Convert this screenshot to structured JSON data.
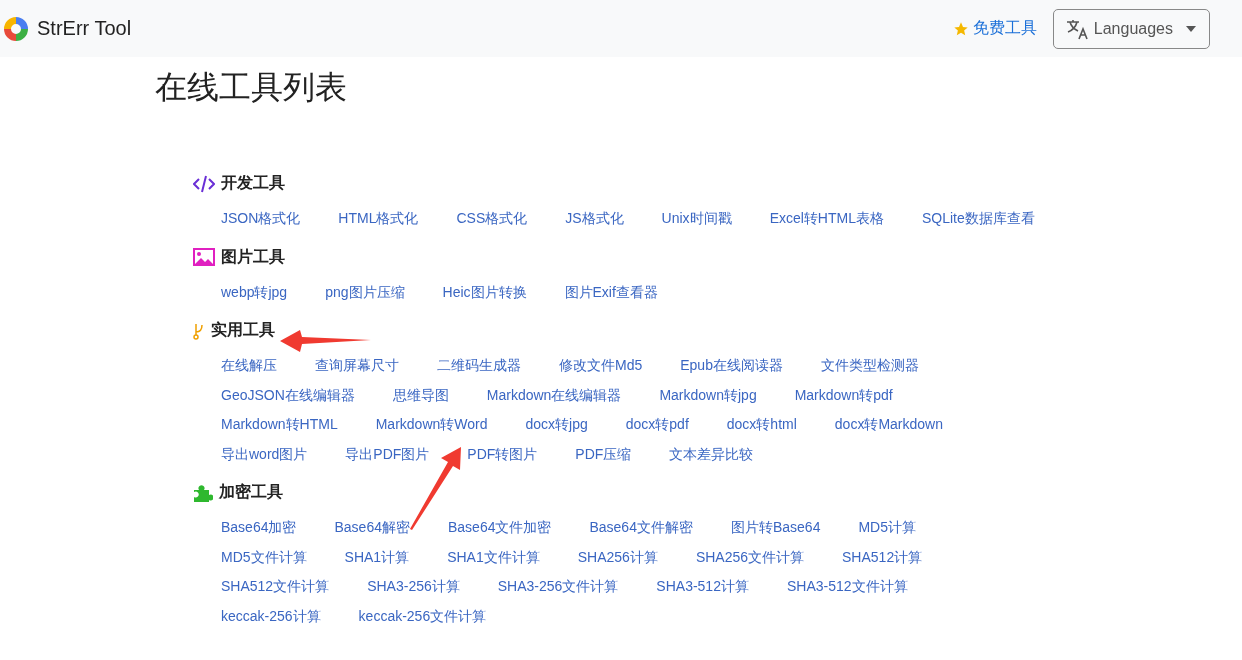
{
  "header": {
    "brand": "StrErr Tool",
    "free_tools": "免费工具",
    "languages": "Languages"
  },
  "title": "在线工具列表",
  "sections": [
    {
      "kind": "code",
      "heading": "开发工具",
      "rows": [
        [
          "JSON格式化",
          "HTML格式化",
          "CSS格式化",
          "JS格式化",
          "Unix时间戳",
          "Excel转HTML表格",
          "SQLite数据库查看"
        ]
      ]
    },
    {
      "kind": "image",
      "heading": "图片工具",
      "rows": [
        [
          "webp转jpg",
          "png图片压缩",
          "Heic图片转换",
          "图片Exif查看器"
        ]
      ]
    },
    {
      "kind": "utility",
      "heading": "实用工具",
      "rows": [
        [
          "在线解压",
          "查询屏幕尺寸",
          "二维码生成器",
          "修改文件Md5",
          "Epub在线阅读器",
          "文件类型检测器"
        ],
        [
          "GeoJSON在线编辑器",
          "思维导图",
          "Markdown在线编辑器",
          "Markdown转jpg",
          "Markdown转pdf"
        ],
        [
          "Markdown转HTML",
          "Markdown转Word",
          "docx转jpg",
          "docx转pdf",
          "docx转html",
          "docx转Markdown"
        ],
        [
          "导出word图片",
          "导出PDF图片",
          "PDF转图片",
          "PDF压缩",
          "文本差异比较"
        ]
      ]
    },
    {
      "kind": "crypto",
      "heading": "加密工具",
      "rows": [
        [
          "Base64加密",
          "Base64解密",
          "Base64文件加密",
          "Base64文件解密",
          "图片转Base64",
          "MD5计算"
        ],
        [
          "MD5文件计算",
          "SHA1计算",
          "SHA1文件计算",
          "SHA256计算",
          "SHA256文件计算",
          "SHA512计算"
        ],
        [
          "SHA512文件计算",
          "SHA3-256计算",
          "SHA3-256文件计算",
          "SHA3-512计算",
          "SHA3-512文件计算"
        ],
        [
          "keccak-256计算",
          "keccak-256文件计算"
        ]
      ]
    }
  ]
}
